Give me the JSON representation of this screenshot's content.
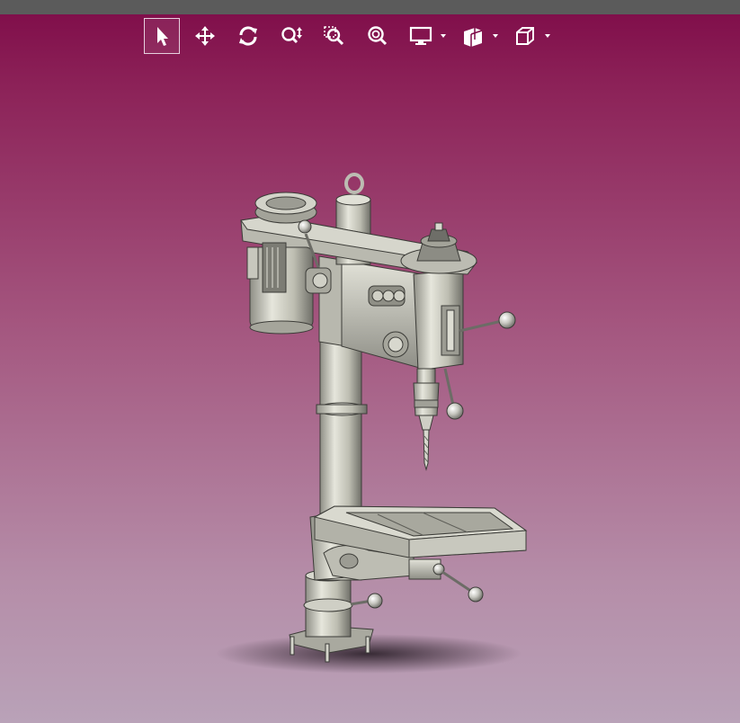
{
  "window": {
    "title_bar": ""
  },
  "toolbar": {
    "tools": [
      {
        "name": "select",
        "icon": "pointer-icon",
        "active": true
      },
      {
        "name": "pan",
        "icon": "move-arrows-icon",
        "active": false
      },
      {
        "name": "rotate",
        "icon": "rotate-icon",
        "active": false
      },
      {
        "name": "zoom",
        "icon": "zoom-updown-icon",
        "active": false
      },
      {
        "name": "zoom-window",
        "icon": "zoom-window-icon",
        "active": false
      },
      {
        "name": "zoom-fit",
        "icon": "zoom-fit-icon",
        "active": false
      },
      {
        "name": "display-mode",
        "icon": "monitor-icon",
        "has_dropdown": true
      },
      {
        "name": "section-view",
        "icon": "section-cube-icon",
        "has_dropdown": true
      },
      {
        "name": "standard-views",
        "icon": "cube-view-icon",
        "has_dropdown": true
      }
    ]
  },
  "scene": {
    "model": "drill-press",
    "background_top": "#7e0b48",
    "background_bottom": "#b9a2b8",
    "model_color": "#c9c9bd"
  }
}
